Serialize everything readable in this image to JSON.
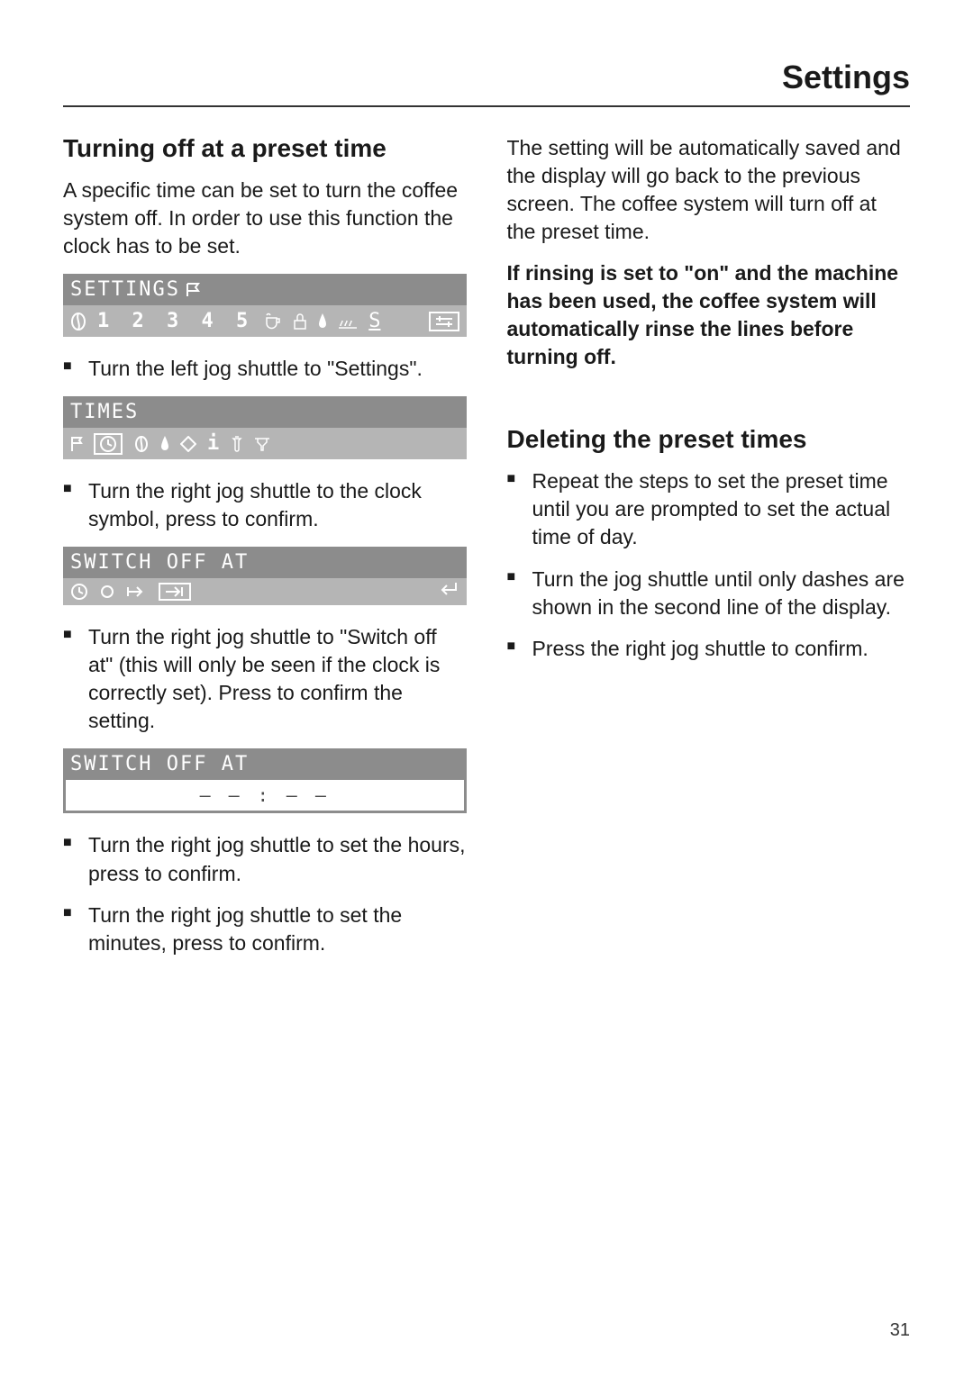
{
  "header": {
    "title": "Settings"
  },
  "left": {
    "h2_1": "Turning off at a preset time",
    "intro": "A specific time can be set to turn the coffee system off. In order to use this function the clock has to be set.",
    "lcd1": {
      "title": "SETTINGS",
      "row2": "1 2 3 4 5"
    },
    "step1": "Turn the left jog shuttle to \"Settings\".",
    "lcd2": {
      "title": "TIMES"
    },
    "step2": "Turn the right jog shuttle to the clock symbol, press to confirm.",
    "lcd3": {
      "title": "SWITCH OFF AT"
    },
    "step3": "Turn the right jog shuttle to \"Switch off at\" (this will only be seen if the clock is correctly set). Press to confirm the setting.",
    "lcd4": {
      "title": "SWITCH OFF AT",
      "value": "– – : – –"
    },
    "step4": "Turn the right jog shuttle to set the hours, press to confirm.",
    "step5": "Turn the right jog shuttle to set the minutes, press to confirm."
  },
  "right": {
    "p1": "The setting will be automatically saved and the display will go back to the previous screen. The coffee system will turn off at the preset time.",
    "p2": "If rinsing is set to \"on\" and the machine has been used, the coffee system will automatically rinse the lines before turning off.",
    "h2_2": "Deleting the preset times",
    "d1": "Repeat the steps to set the preset time until you are prompted to set the actual time of day.",
    "d2": "Turn the jog shuttle until only dashes are shown in the second line of the display.",
    "d3": "Press the right jog shuttle to confirm."
  },
  "page_number": "31"
}
